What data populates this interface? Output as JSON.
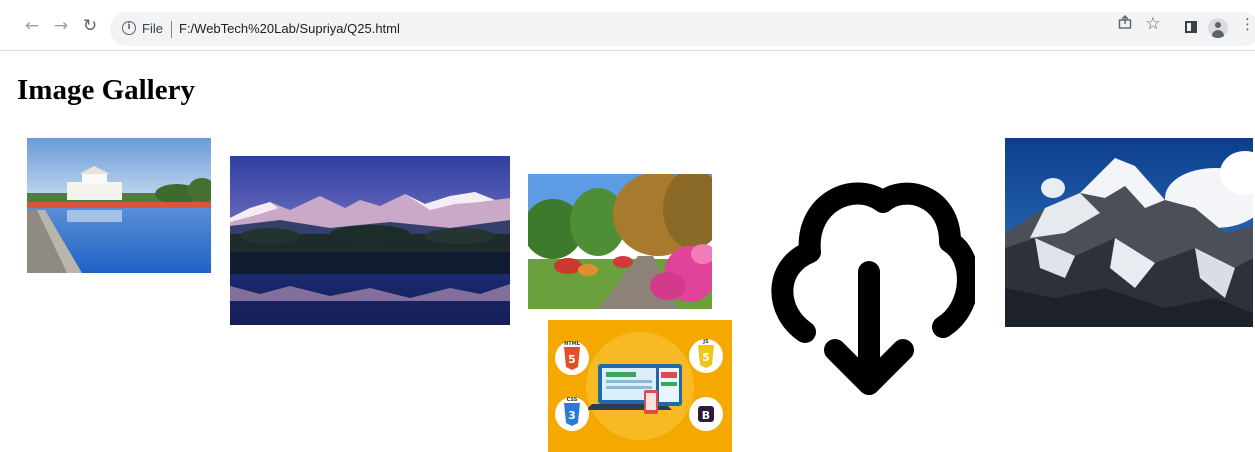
{
  "browser": {
    "back_icon": "arrow-left-icon",
    "forward_icon": "arrow-right-icon",
    "reload_icon": "reload-icon",
    "info_icon": "info-icon",
    "scheme_label": "File",
    "url": "F:/WebTech%20Lab/Supriya/Q25.html",
    "right_icons": [
      "share-icon",
      "star-icon",
      "side-panel-icon",
      "profile-icon",
      "menu-icon"
    ]
  },
  "page": {
    "title": "Image Gallery",
    "images": [
      {
        "name": "temple-lake-photo"
      },
      {
        "name": "mountain-lake-reflection-photo"
      },
      {
        "name": "garden-path-photo"
      },
      {
        "name": "web-technologies-illustration"
      },
      {
        "name": "cloud-download-icon"
      },
      {
        "name": "snowy-mountain-photo"
      }
    ],
    "tech_badges": [
      "HTML",
      "JS",
      "CSS",
      "B"
    ]
  },
  "colors": {
    "omnibox_bg": "#f1f3f4",
    "tech_bg": "#f5a800"
  }
}
